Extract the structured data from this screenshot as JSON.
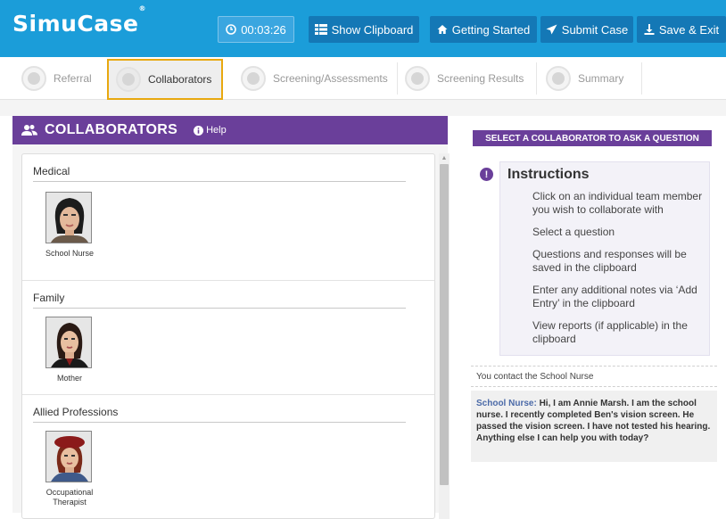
{
  "app": {
    "logo": "SimuCase",
    "logo_mark": "®"
  },
  "toolbar": {
    "timer": "00:03:26",
    "show_clipboard": "Show Clipboard",
    "getting_started": "Getting Started",
    "submit_case": "Submit Case",
    "save_exit": "Save & Exit"
  },
  "steps": [
    {
      "label": "Referral"
    },
    {
      "label": "Collaborators"
    },
    {
      "label": "Screening/Assessments"
    },
    {
      "label": "Screening Results"
    },
    {
      "label": "Summary"
    }
  ],
  "collaborators": {
    "title": "COLLABORATORS",
    "help": "Help",
    "groups": [
      {
        "title": "Medical",
        "member": "School Nurse"
      },
      {
        "title": "Family",
        "member": "Mother"
      },
      {
        "title": "Allied Professions",
        "member": "Occupational Therapist"
      }
    ]
  },
  "right": {
    "header": "SELECT A COLLABORATOR TO ASK A QUESTION",
    "instructions_title": "Instructions",
    "instructions": [
      "Click on an individual team member you wish to collaborate with",
      "Select a question",
      "Questions and responses will be saved in the clipboard",
      "Enter any additional notes via ‘Add Entry’ in the clipboard",
      "View reports (if applicable) in the clipboard"
    ],
    "contact": "You contact the School Nurse",
    "response_speaker": "School Nurse:",
    "response_text": "Hi, I am Annie Marsh. I am the school nurse. I recently completed Ben's vision screen. He passed the vision screen. I have not tested his hearing. Anything else I can help you with today?"
  },
  "colors": {
    "topbar": "#1b9dd9",
    "button": "#1478b6",
    "purple": "#6a3f9a",
    "highlight": "#e8a80f"
  }
}
